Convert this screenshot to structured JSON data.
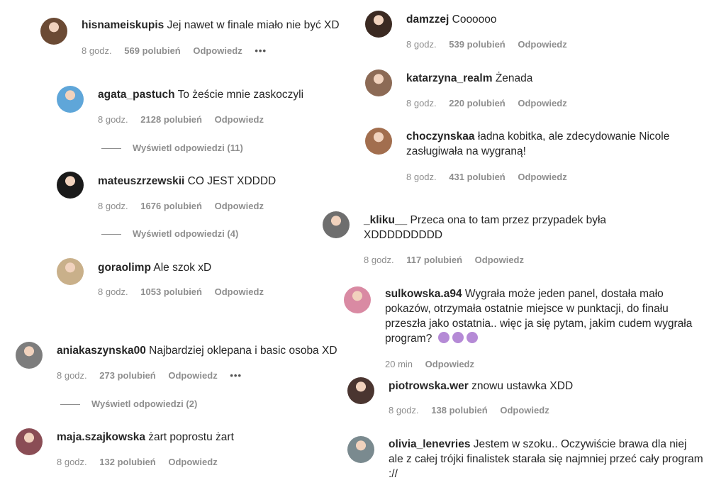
{
  "labels": {
    "reply": "Odpowiedz",
    "more": "•••"
  },
  "left": [
    {
      "user": "hisnameiskupis",
      "text": "Jej nawet w finale miało nie być XD",
      "time": "8 godz.",
      "likes": "569 polubień",
      "more": true,
      "av": "#6b4a34"
    },
    {
      "user": "agata_pastuch",
      "text": "To żeście mnie zaskoczyli",
      "time": "8 godz.",
      "likes": "2128 polubień",
      "replies": "Wyświetl odpowiedzi (11)",
      "av": "#5fa6d9"
    },
    {
      "user": "mateuszrzewskii",
      "text": "CO JEST XDDDD",
      "time": "8 godz.",
      "likes": "1676 polubień",
      "replies": "Wyświetl odpowiedzi (4)",
      "av": "#1a1a1a"
    },
    {
      "user": "goraolimp",
      "text": "Ale szok xD",
      "time": "8 godz.",
      "likes": "1053 polubień",
      "av": "#c9b08a"
    },
    {
      "user": "aniakaszynska00",
      "text": "Najbardziej oklepana i basic osoba XD",
      "time": "8 godz.",
      "likes": "273 polubień",
      "more": true,
      "replies": "Wyświetl odpowiedzi (2)",
      "av": "#7d7d7d"
    },
    {
      "user": "maja.szajkowska",
      "text": "żart poprostu żart",
      "time": "8 godz.",
      "likes": "132 polubień",
      "av": "#8a4d55"
    }
  ],
  "right": [
    {
      "user": "damzzej",
      "text": "Coooooo",
      "time": "8 godz.",
      "likes": "539 polubień",
      "av": "#3b2a22"
    },
    {
      "user": "katarzyna_realm",
      "text": "Żenada",
      "time": "8 godz.",
      "likes": "220 polubień",
      "av": "#8c6a55"
    },
    {
      "user": "choczynskaa",
      "text": "ładna kobitka, ale zdecydowanie Nicole zasługiwała na wygraną!",
      "time": "8 godz.",
      "likes": "431 polubień",
      "av": "#a26e4e"
    },
    {
      "user": "_kliku__",
      "text": "Przeca ona to tam przez przypadek była XDDDDDDDDD",
      "time": "8 godz.",
      "likes": "117 polubień",
      "av": "#6e6e6e"
    },
    {
      "user": "sulkowska.a94",
      "text": "Wygrała może jeden panel, dostała mało pokazów, otrzymała ostatnie miejsce w punktacji, do finału przeszła jako ostatnia.. więc ja się pytam, jakim cudem wygrała program?",
      "time": "20 min",
      "likes": "",
      "emoji": "woman-shrugging-emoji",
      "av": "#d98aa3"
    },
    {
      "user": "piotrowska.wer",
      "text": "znowu ustawka XDD",
      "time": "8 godz.",
      "likes": "138 polubień",
      "av": "#4a3530"
    },
    {
      "user": "olivia_lenevries",
      "text": "Jestem w szoku.. Oczywiście brawa dla niej ale z całej trójki finalistek starała się najmniej przeć cały program ://",
      "time": "",
      "likes": "",
      "av": "#7a8a8f"
    }
  ]
}
